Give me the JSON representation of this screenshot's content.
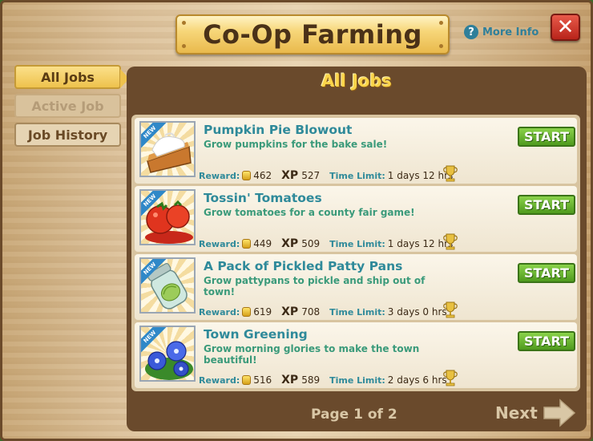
{
  "dialog": {
    "title": "Co-Op Farming",
    "more_info": "More Info",
    "close_symbol": "✕"
  },
  "tabs": [
    {
      "label": "All Jobs",
      "state": "active"
    },
    {
      "label": "Active Job",
      "state": "disabled"
    },
    {
      "label": "Job History",
      "state": "normal"
    }
  ],
  "panel": {
    "title": "All Jobs",
    "page_label": "Page 1 of 2",
    "next_label": "Next"
  },
  "job_labels": {
    "reward": "Reward:",
    "xp": "XP",
    "time_limit": "Time Limit:",
    "start": "START",
    "new_badge": "NEW"
  },
  "jobs": [
    {
      "name": "Pumpkin Pie Blowout",
      "description": "Grow pumpkins for the bake sale!",
      "coins": "462",
      "xp": "527",
      "time_limit": "1 days 12 hrs",
      "icon": "pumpkin-pie-icon"
    },
    {
      "name": "Tossin' Tomatoes",
      "description": "Grow tomatoes for a county fair game!",
      "coins": "449",
      "xp": "509",
      "time_limit": "1 days 12 hrs",
      "icon": "tomatoes-icon"
    },
    {
      "name": "A Pack of Pickled Patty Pans",
      "description": "Grow pattypans to pickle and ship out of town!",
      "coins": "619",
      "xp": "708",
      "time_limit": "3 days 0 hrs",
      "icon": "pickle-jar-icon"
    },
    {
      "name": "Town Greening",
      "description": "Grow morning glories to make the town beautiful!",
      "coins": "516",
      "xp": "589",
      "time_limit": "2 days 6 hrs",
      "icon": "morning-glory-icon"
    }
  ],
  "colors": {
    "accent_gold": "#fbd54a",
    "start_green": "#4f9a1e",
    "close_red": "#b8241a",
    "job_title_teal": "#2f8a9a"
  }
}
